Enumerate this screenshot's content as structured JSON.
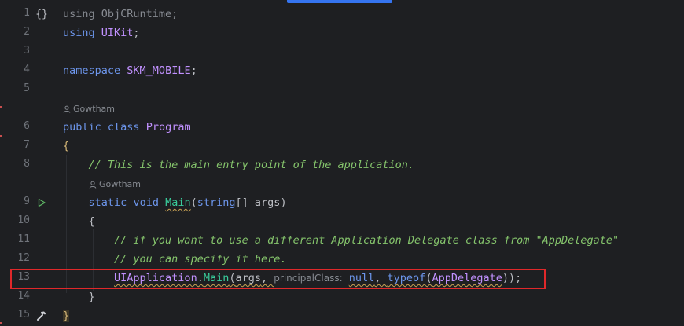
{
  "editor": {
    "lines": [
      {
        "num": "1",
        "text": "using ObjCRuntime;"
      },
      {
        "num": "2"
      },
      {
        "num": "3"
      },
      {
        "num": "4"
      },
      {
        "num": "5"
      },
      {
        "num": "6"
      },
      {
        "num": "7"
      },
      {
        "num": "8"
      },
      {
        "num": "9"
      },
      {
        "num": "10"
      },
      {
        "num": "11"
      },
      {
        "num": "12"
      },
      {
        "num": "13"
      },
      {
        "num": "14"
      },
      {
        "num": "15"
      }
    ],
    "tokens": {
      "using": "using",
      "uikit": "UIKit",
      "namespace": "namespace",
      "skm_mobile": "SKM_MOBILE",
      "public": "public",
      "class": "class",
      "program": "Program",
      "comment_main": "// This is the main entry point of the application.",
      "static": "static",
      "void": "void",
      "main": "Main",
      "string": "string",
      "args_param": "args",
      "comment_11": "// if you want to use a different Application Delegate class from \"AppDelegate\"",
      "comment_12": "// you can specify it here.",
      "uiapplication": "UIApplication",
      "args": "args",
      "hint_principal": "principalClass:",
      "null": "null",
      "typeof": "typeof",
      "appdelegate": "AppDelegate"
    },
    "authors": {
      "class_author": "Gowtham",
      "method_author": "Gowtham"
    },
    "icons": {
      "line1": "fold-braces-icon",
      "line9": "run-gutter-icon",
      "line15": "build-hammer-icon"
    }
  }
}
